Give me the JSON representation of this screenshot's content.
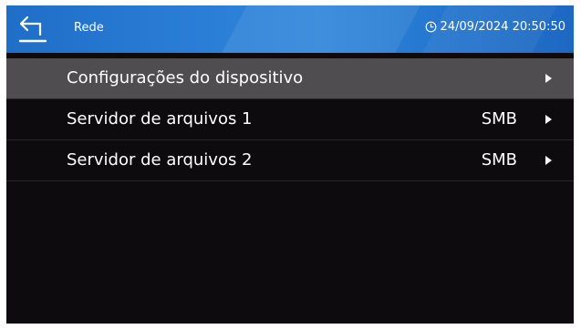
{
  "header": {
    "back_icon": "back-arrow-icon",
    "title": "Rede",
    "clock_icon": "clock-icon",
    "datetime": "24/09/2024 20:50:50"
  },
  "menu": {
    "items": [
      {
        "label": "Configurações do dispositivo",
        "value": "",
        "selected": true,
        "icon": "chevron-right-icon"
      },
      {
        "label": "Servidor de arquivos 1",
        "value": "SMB",
        "selected": false,
        "icon": "chevron-right-icon"
      },
      {
        "label": "Servidor de arquivos 2",
        "value": "SMB",
        "selected": false,
        "icon": "chevron-right-icon"
      }
    ]
  },
  "colors": {
    "header_blue": "#2b7ed6",
    "background": "#0d0b0d",
    "selected_row": "#4f4d50",
    "text": "#ffffff"
  }
}
